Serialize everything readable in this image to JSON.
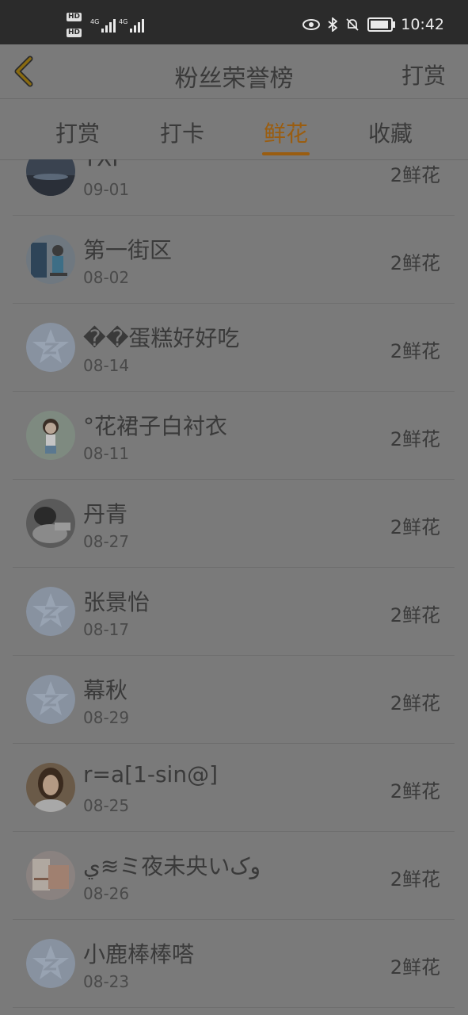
{
  "status_bar": {
    "time": "10:42",
    "network": "4G"
  },
  "header": {
    "title": "粉丝荣誉榜",
    "action_label": "打赏"
  },
  "tabs": [
    {
      "label": "打赏"
    },
    {
      "label": "打卡"
    },
    {
      "label": "鲜花"
    },
    {
      "label": "收藏"
    }
  ],
  "active_tab": "鲜花",
  "colors": {
    "accent": "#9a5d10",
    "overlay": "#7a7a7a"
  },
  "rows": [
    {
      "name": "TXF",
      "date": "09-01",
      "amount": "2鲜花",
      "avatar": "photo-dark-landscape"
    },
    {
      "name": "第一街区",
      "date": "08-02",
      "amount": "2鲜花",
      "avatar": "photo-person-blue"
    },
    {
      "name": "��蛋糕好好吃",
      "date": "08-14",
      "amount": "2鲜花",
      "avatar": "default-qq-star"
    },
    {
      "name": "°花裙子白衬衣",
      "date": "08-11",
      "amount": "2鲜花",
      "avatar": "photo-cartoon-girl"
    },
    {
      "name": "丹青",
      "date": "08-27",
      "amount": "2鲜花",
      "avatar": "photo-bw-portrait"
    },
    {
      "name": "张景怡",
      "date": "08-17",
      "amount": "2鲜花",
      "avatar": "default-qq-star"
    },
    {
      "name": "幕秋",
      "date": "08-29",
      "amount": "2鲜花",
      "avatar": "default-qq-star"
    },
    {
      "name": "r=a[1-sin@]",
      "date": "08-25",
      "amount": "2鲜花",
      "avatar": "photo-woman-portrait"
    },
    {
      "name": "ي≋ミ夜未央いوک",
      "date": "08-26",
      "amount": "2鲜花",
      "avatar": "photo-book-cover"
    },
    {
      "name": "小鹿棒棒嗒",
      "date": "08-23",
      "amount": "2鲜花",
      "avatar": "default-qq-star"
    }
  ]
}
